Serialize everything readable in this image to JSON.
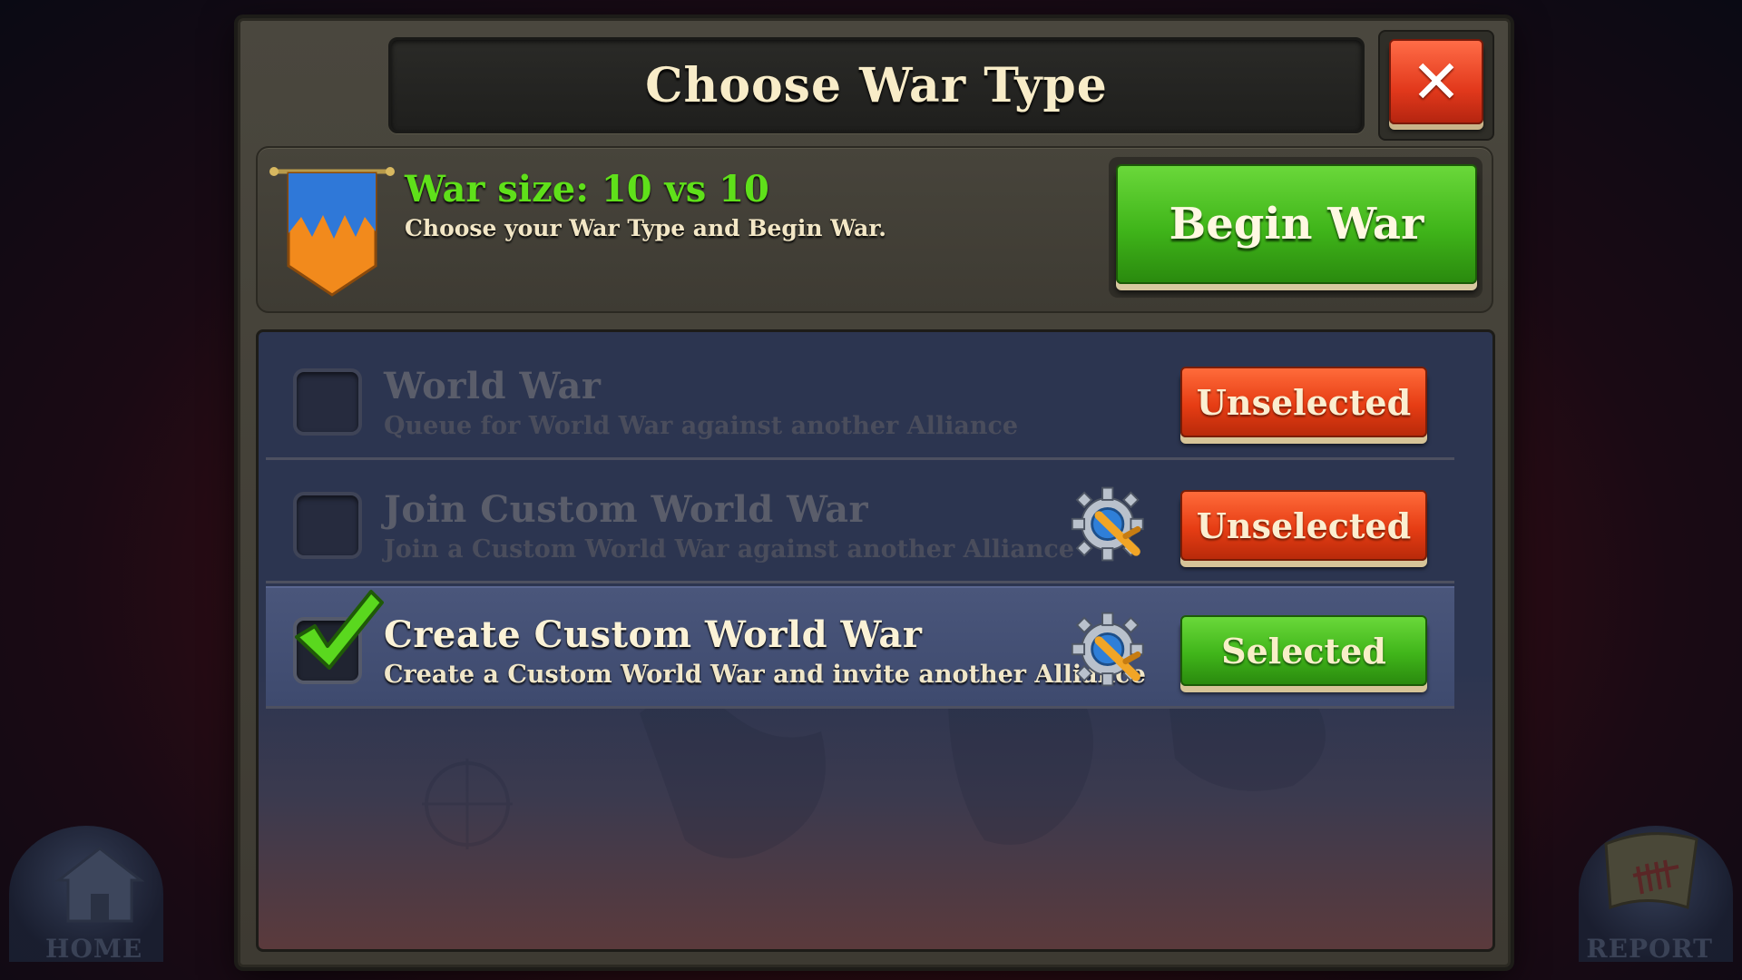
{
  "dialog": {
    "title": "Choose War Type",
    "close_label": "✕"
  },
  "info": {
    "war_size": "War size: 10 vs 10",
    "subtitle": "Choose your War Type and Begin War.",
    "begin_label": "Begin War"
  },
  "options": [
    {
      "title": "World War",
      "description": "Queue for World War against another Alliance",
      "checked": false,
      "state_label": "Unselected",
      "state_color": "#e63d14",
      "has_settings_icon": false
    },
    {
      "title": "Join Custom World War",
      "description": "Join a Custom World War against another Alliance",
      "checked": false,
      "state_label": "Unselected",
      "state_color": "#e63d14",
      "has_settings_icon": true
    },
    {
      "title": "Create Custom World War",
      "description": "Create a Custom World War and invite another Alliance",
      "checked": true,
      "state_label": "Selected",
      "state_color": "#40b51a",
      "has_settings_icon": true
    }
  ],
  "bottom_nav": {
    "home_label": "HOME",
    "report_label": "REPORT"
  },
  "colors": {
    "accent_green": "#5fe01a",
    "title_text": "#f8ecc8",
    "panel_bg": "#47443b"
  }
}
